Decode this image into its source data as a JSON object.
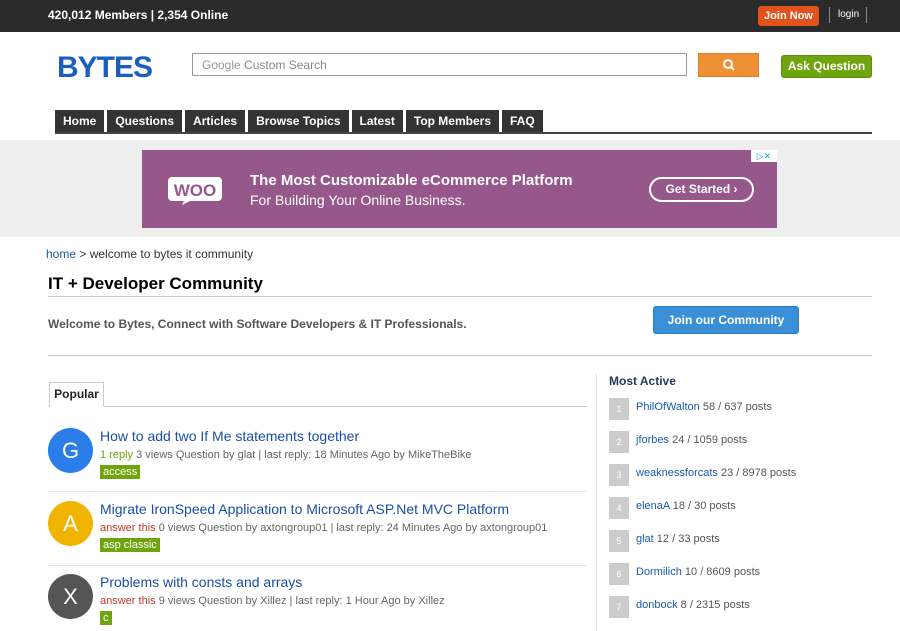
{
  "topbar": {
    "stats": "420,012 Members | 2,354 Online",
    "join": "Join Now",
    "login": "login"
  },
  "header": {
    "logo": "BYTES",
    "search_placeholder": "Custom Search",
    "search_google": "Google",
    "ask": "Ask Question"
  },
  "nav": [
    "Home",
    "Questions",
    "Articles",
    "Browse Topics",
    "Latest",
    "Top Members",
    "FAQ"
  ],
  "ad": {
    "logo": "WOO",
    "headline": "The Most Customizable eCommerce Platform",
    "subline": "For Building Your Online Business.",
    "cta": "Get Started"
  },
  "breadcrumb": {
    "home": "home",
    "sep": " > ",
    "current": "welcome to bytes it community"
  },
  "page": {
    "title": "IT + Developer Community",
    "welcome": "Welcome to Bytes, Connect with Software Developers & IT Professionals.",
    "join_btn": "Join our Community"
  },
  "tabs": {
    "popular": "Popular"
  },
  "questions": [
    {
      "letter": "G",
      "color": "#2b7de9",
      "title": "How to add two If Me statements together",
      "status": "1 reply",
      "status_type": "reply",
      "rest": " 3 views  Question by glat | last reply: 18 Minutes Ago by MikeTheBike",
      "tag": "access"
    },
    {
      "letter": "A",
      "color": "#f0b400",
      "title": "Migrate IronSpeed Application to Microsoft ASP.Net MVC Platform",
      "status": "answer this",
      "status_type": "answer",
      "rest": " 0 views  Question by axtongroup01 | last reply: 24 Minutes Ago by axtongroup01",
      "tag": "asp classic"
    },
    {
      "letter": "X",
      "color": "#555555",
      "title": "Problems with consts and arrays",
      "status": "answer this",
      "status_type": "answer",
      "rest": " 9 views  Question by Xillez | last reply: 1 Hour Ago by Xillez",
      "tag": "c"
    }
  ],
  "most_active": {
    "title": "Most Active",
    "members": [
      {
        "rank": "1",
        "name": "PhilOfWalton",
        "count": " 58 / 637 posts"
      },
      {
        "rank": "2",
        "name": "jforbes",
        "count": " 24 / 1059 posts"
      },
      {
        "rank": "3",
        "name": "weaknessforcats",
        "count": " 23 / 8978 posts"
      },
      {
        "rank": "4",
        "name": "elenaA",
        "count": " 18 / 30 posts"
      },
      {
        "rank": "5",
        "name": "glat",
        "count": " 12 / 33 posts"
      },
      {
        "rank": "6",
        "name": "Dormilich",
        "count": " 10 / 8609 posts"
      },
      {
        "rank": "7",
        "name": "donbock",
        "count": " 8 / 2315 posts"
      }
    ]
  }
}
